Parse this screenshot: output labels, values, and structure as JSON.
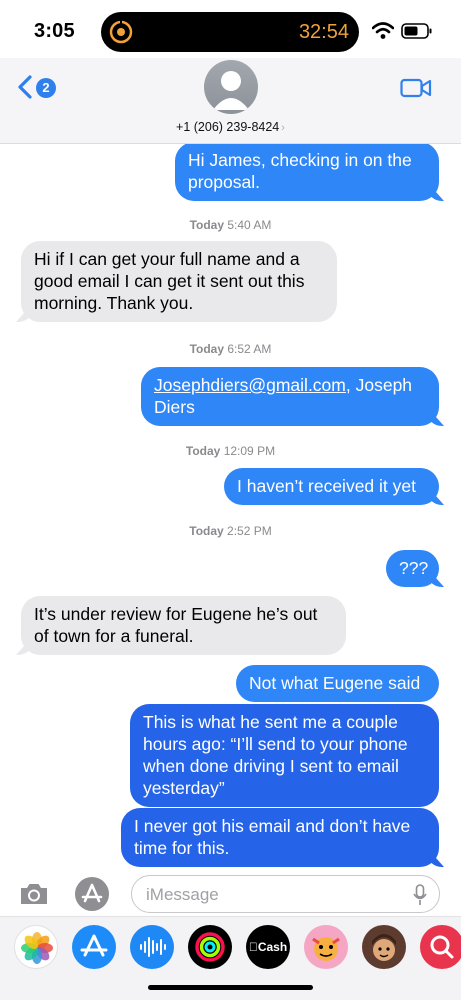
{
  "status_bar": {
    "time": "3:05",
    "timer": "32:54",
    "timer_color": "#f0a23a"
  },
  "header": {
    "back_badge": "2",
    "contact": "+1 (206) 239-8424",
    "contact_arrow": "›"
  },
  "messages": [
    {
      "dir": "out",
      "text": "Hi James, checking in on the proposal."
    },
    {
      "type": "stamp",
      "day": "Today",
      "time": "5:40 AM"
    },
    {
      "dir": "in",
      "text": "Hi if I can get your full name and a good email I can get it sent out this morning. Thank you."
    },
    {
      "type": "stamp",
      "day": "Today",
      "time": "6:52 AM"
    },
    {
      "dir": "out",
      "link": "Josephdiers@gmail.com",
      "text": ", Joseph Diers"
    },
    {
      "type": "stamp",
      "day": "Today",
      "time": "12:09 PM"
    },
    {
      "dir": "out",
      "text": "I haven’t received it yet"
    },
    {
      "type": "stamp",
      "day": "Today",
      "time": "2:52 PM"
    },
    {
      "dir": "out",
      "text": "???"
    },
    {
      "dir": "in",
      "text": "It’s under review for Eugene he’s out of town for a funeral."
    },
    {
      "dir": "out",
      "text": "Not what Eugene said"
    },
    {
      "dir": "out",
      "text": "This is what he sent me a couple hours ago: “I’ll send to your phone when done driving I sent to email yesterday”"
    },
    {
      "dir": "out",
      "text": "I never got his email and don’t have time for this."
    }
  ],
  "input": {
    "placeholder": "iMessage",
    "value": ""
  },
  "app_strip": {
    "items": [
      "photos-icon",
      "app-store-icon",
      "audio-message-icon",
      "fitness-icon",
      "apple-cash-icon",
      "memoji-icon",
      "memoji-icon-2",
      "search-images-icon"
    ],
    "cash_label": "Cash"
  },
  "colors": {
    "outgoing_bubble": "#2f86f6",
    "outgoing_bubble_dark": "#2563e8",
    "incoming_bubble": "#e9e9eb",
    "accent": "#2f80ed"
  }
}
